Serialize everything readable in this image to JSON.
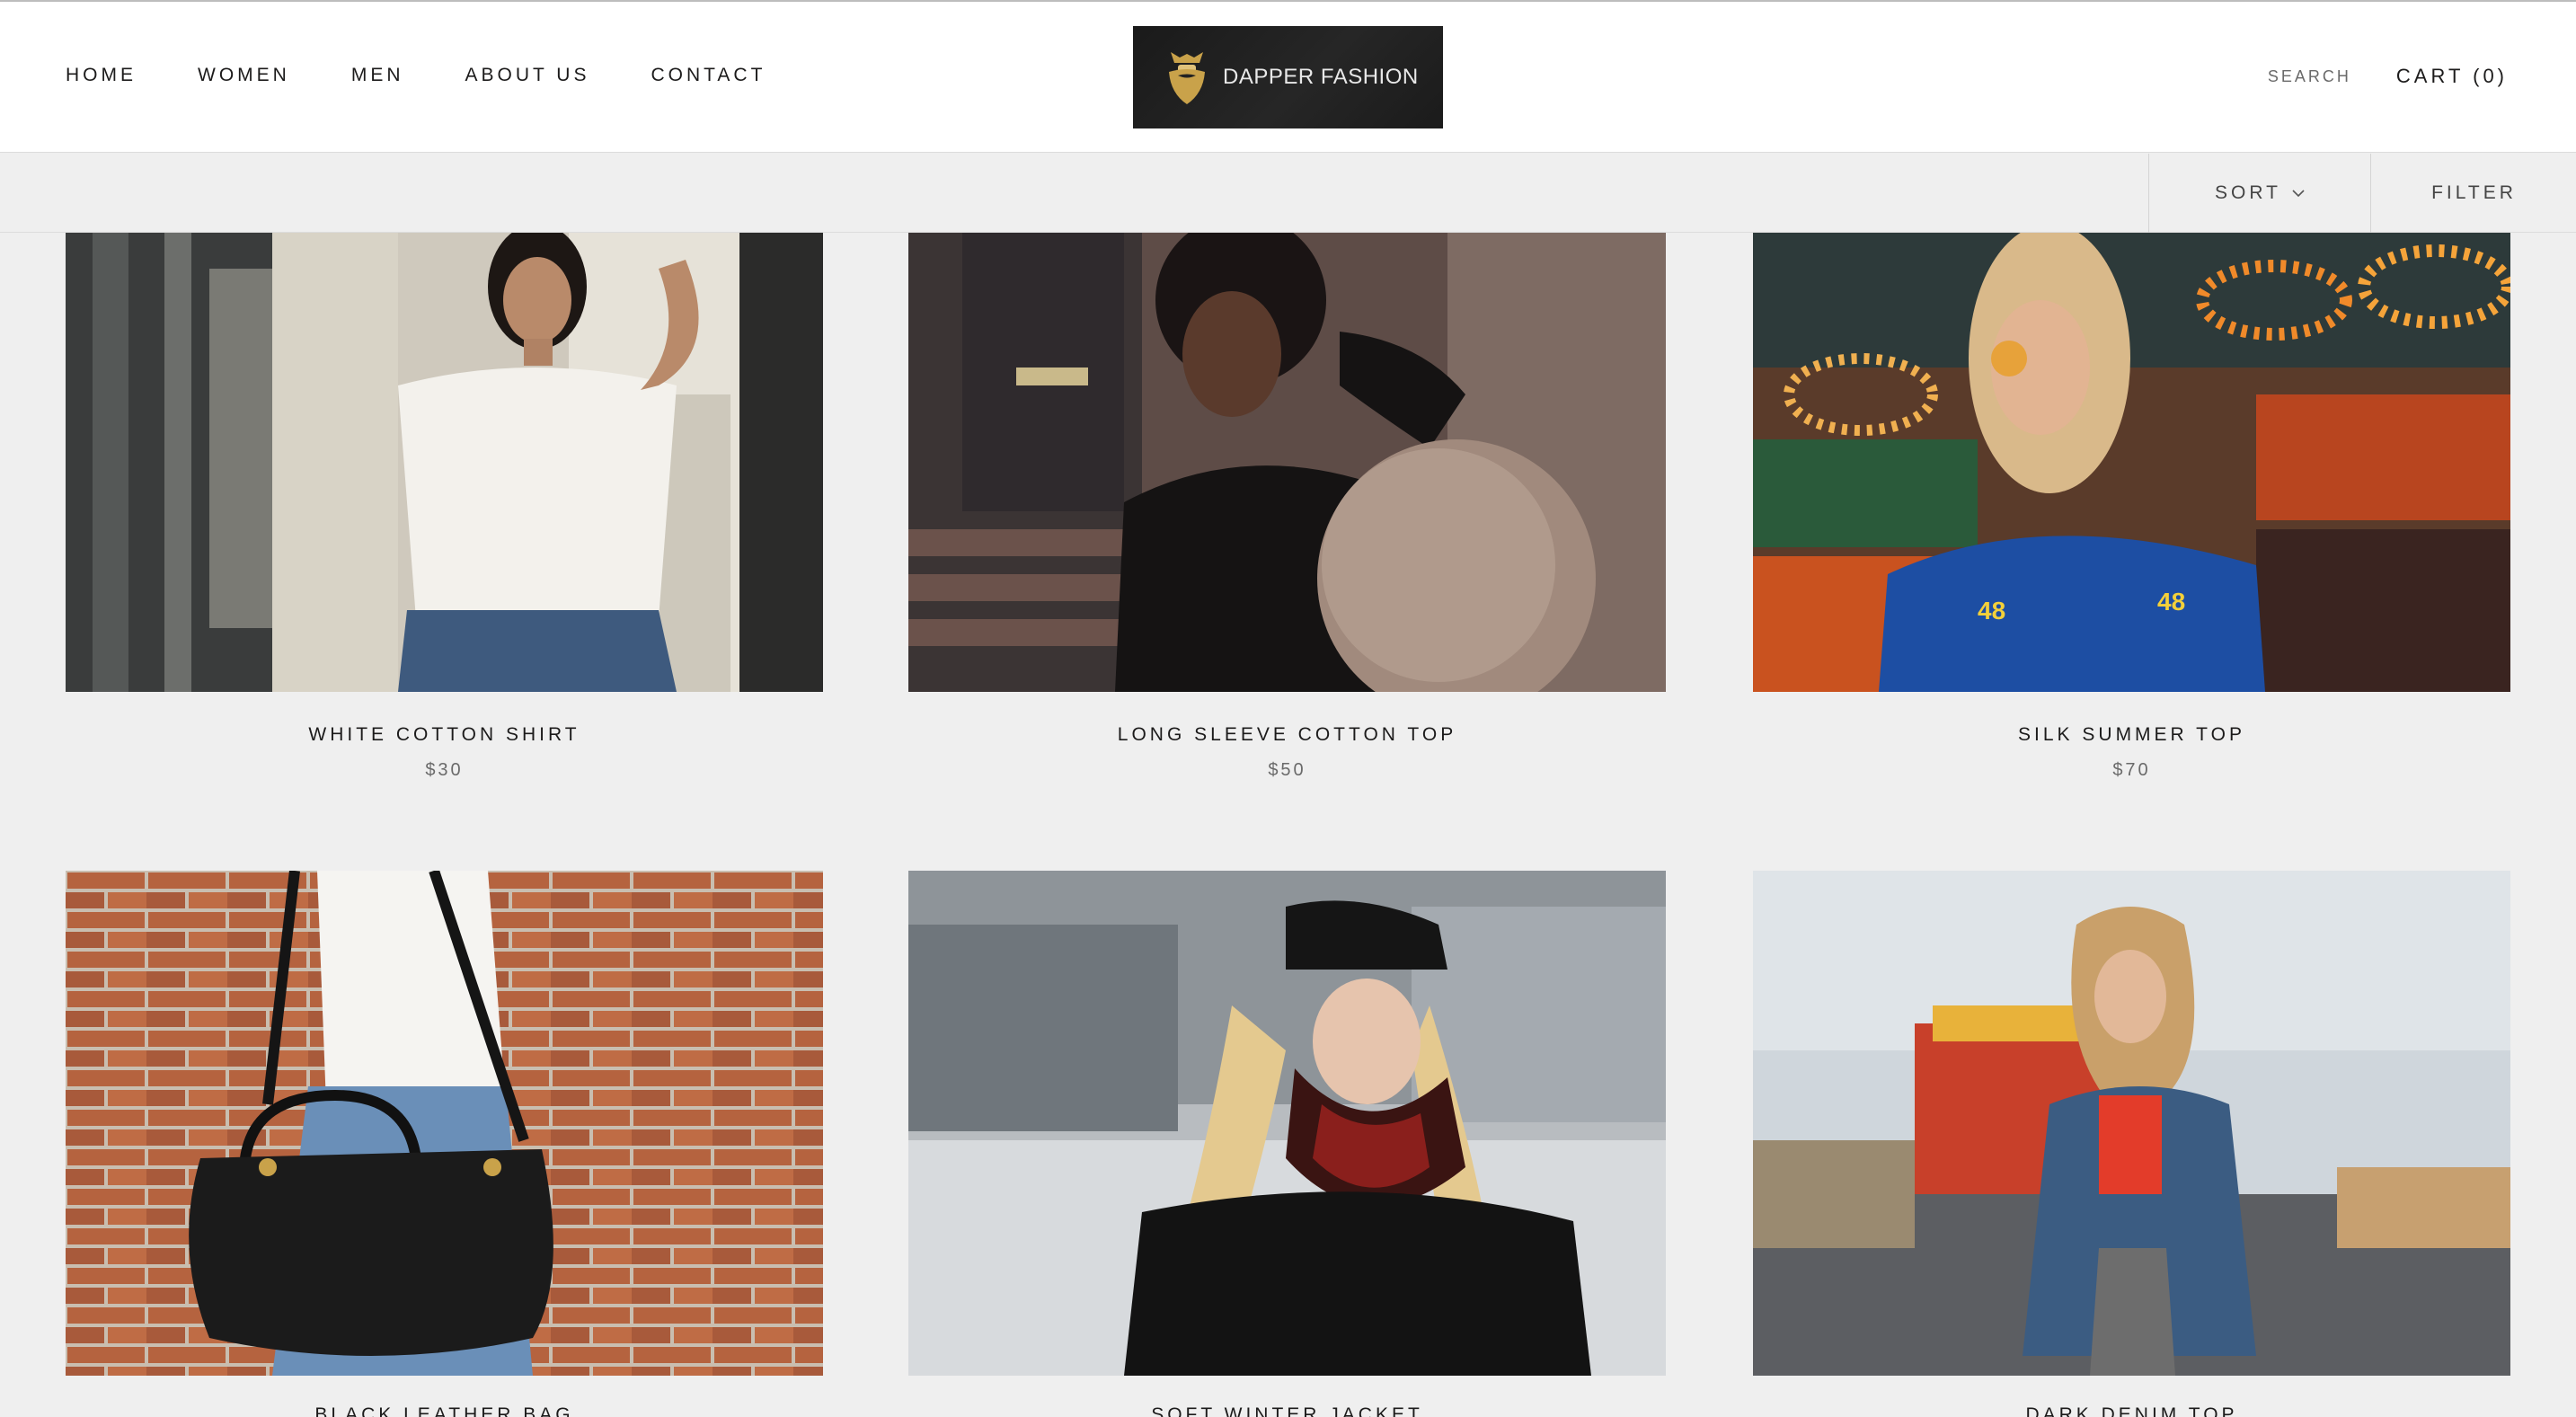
{
  "header": {
    "nav": [
      "HOME",
      "WOMEN",
      "MEN",
      "ABOUT US",
      "CONTACT"
    ],
    "logo_text": "DAPPER FASHION",
    "search_label": "SEARCH",
    "cart_label": "CART (0)"
  },
  "toolbar": {
    "sort_label": "SORT",
    "filter_label": "FILTER"
  },
  "products": [
    {
      "name": "WHITE COTTON SHIRT",
      "price": "$30"
    },
    {
      "name": "LONG SLEEVE COTTON TOP",
      "price": "$50"
    },
    {
      "name": "SILK SUMMER TOP",
      "price": "$70"
    },
    {
      "name": "BLACK LEATHER BAG",
      "price": ""
    },
    {
      "name": "SOFT WINTER JACKET",
      "price": ""
    },
    {
      "name": "DARK DENIM TOP",
      "price": ""
    }
  ],
  "colors": {
    "text": "#1c1b1b",
    "muted": "#6a6a6a",
    "background": "#efefef",
    "header": "#ffffff",
    "logo_bg": "#1f1f1f",
    "logo_gold": "#c9a24a"
  }
}
